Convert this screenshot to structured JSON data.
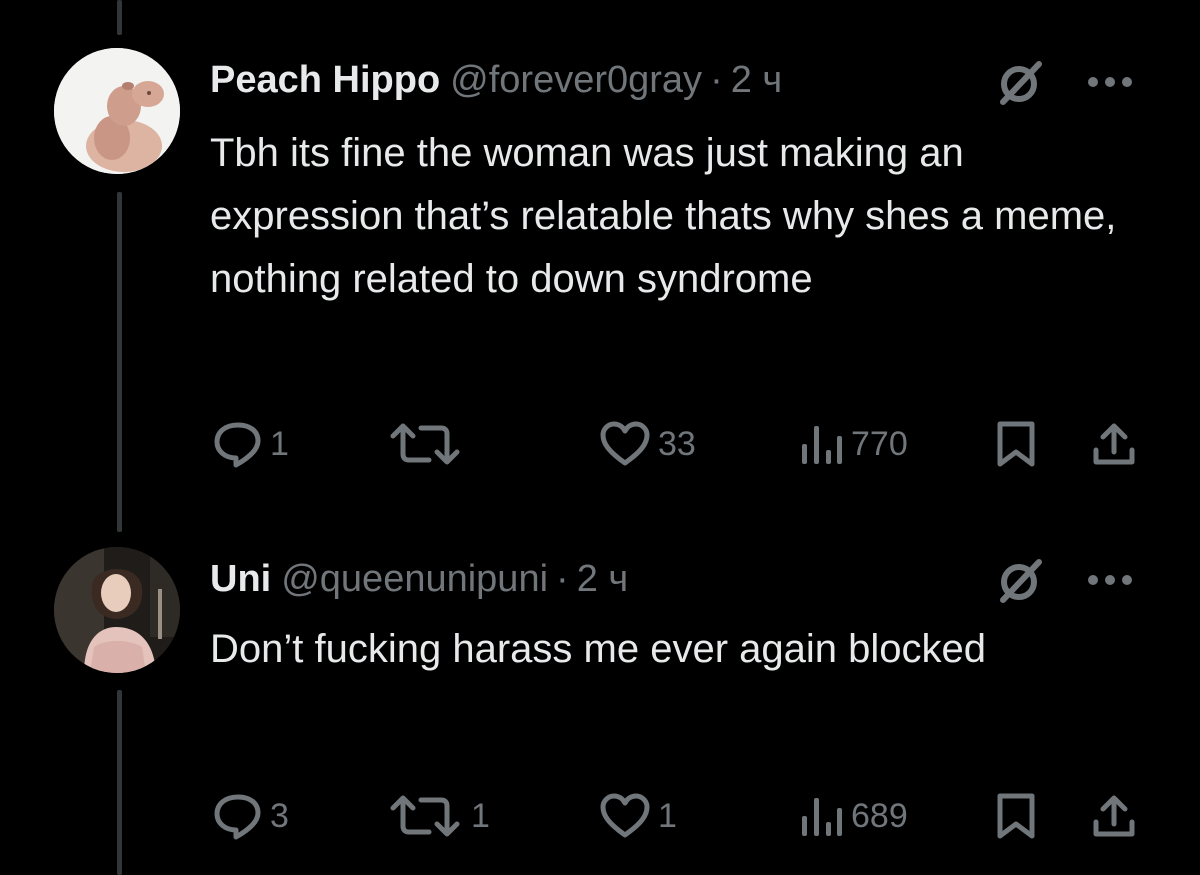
{
  "colors": {
    "background": "#000000",
    "text_primary": "#e7e9ea",
    "text_secondary": "#71767b",
    "thread_line": "#333639"
  },
  "tweets": [
    {
      "display_name": "Peach Hippo",
      "handle": "@forever0gray",
      "separator": "·",
      "time": "2 ч",
      "text": "Tbh its fine the woman was just making an expression that’s relatable thats why shes a meme, nothing related to down syndrome",
      "icons": [
        "grok-icon",
        "more-icon"
      ],
      "stats": {
        "replies": "1",
        "retweets": "",
        "likes": "33",
        "views": "770"
      }
    },
    {
      "display_name": "Uni",
      "handle": "@queenunipuni",
      "separator": "·",
      "time": "2 ч",
      "text": "Don’t fucking harass me ever again blocked",
      "icons": [
        "grok-icon",
        "more-icon"
      ],
      "stats": {
        "replies": "3",
        "retweets": "1",
        "likes": "1",
        "views": "689"
      }
    }
  ]
}
